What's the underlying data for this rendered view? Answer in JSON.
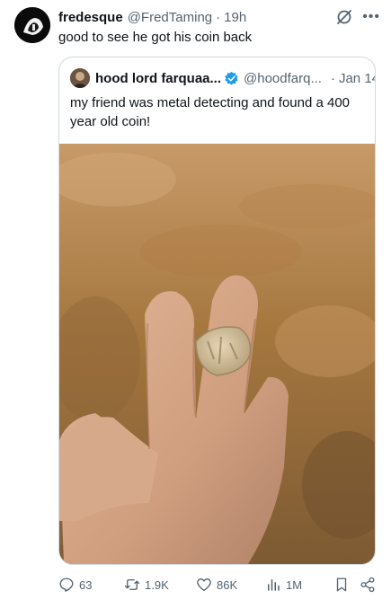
{
  "tweet": {
    "display_name": "fredesque",
    "handle": "@FredTaming",
    "separator": "·",
    "time": "19h",
    "text": "good to see he got his coin back",
    "more_icon": "more-icon",
    "grok_icon": "grok-icon"
  },
  "quote": {
    "display_name": "hood lord farquaa...",
    "verified_icon": "verified-badge-icon",
    "handle": "@hoodfarq...",
    "separator": "·",
    "date": "Jan 14",
    "text": "my friend was metal detecting and found a 400 year old coin!"
  },
  "actions": {
    "replies": "63",
    "reposts": "1.9K",
    "likes": "86K",
    "views": "1M"
  },
  "colors": {
    "text": "#0f1419",
    "secondary": "#536471",
    "border": "#cfd9de",
    "verified": "#1d9bf0"
  }
}
